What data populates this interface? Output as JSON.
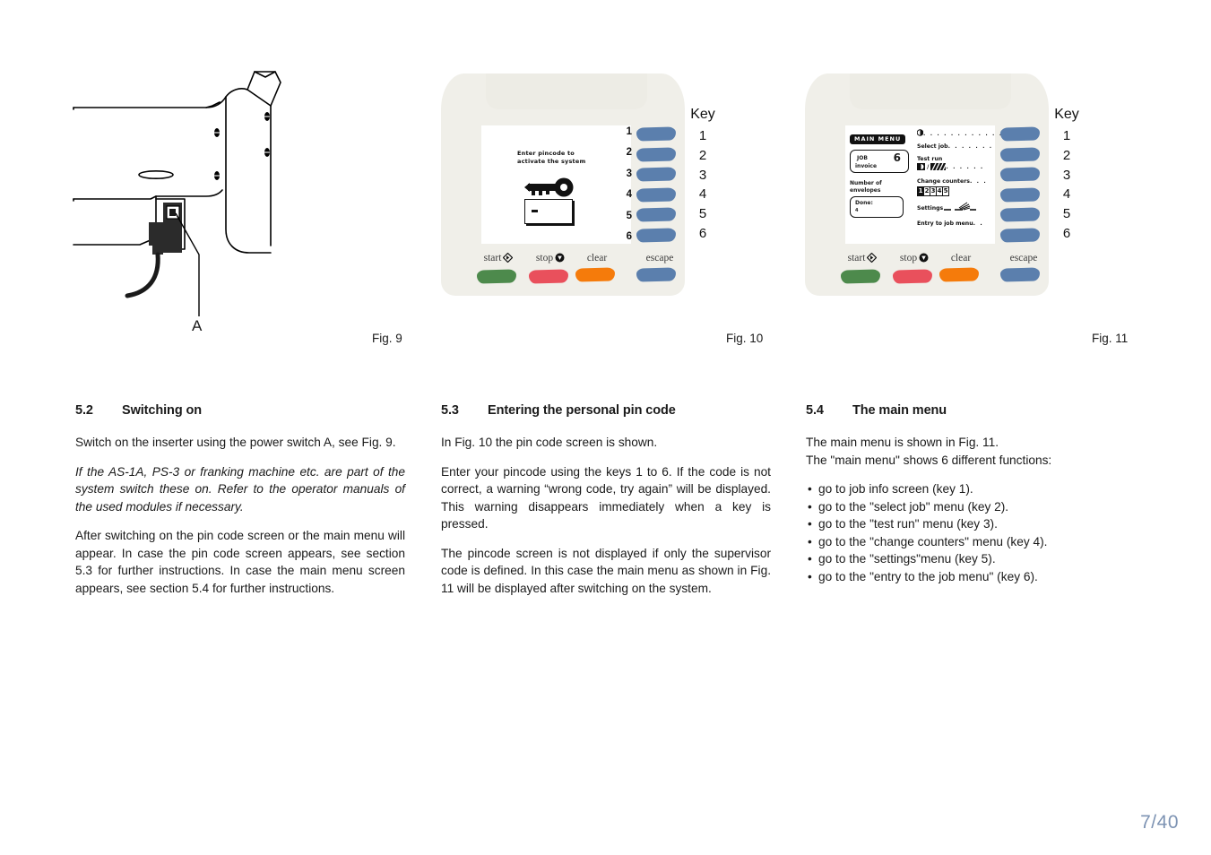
{
  "page": {
    "number": "7/40"
  },
  "figures": {
    "fig9": {
      "caption": "Fig. 9",
      "callout_label": "A",
      "description": "Line drawing of inserter rear corner showing power switch A and mains cable"
    },
    "fig10": {
      "caption": "Fig. 10",
      "key_column_title": "Key",
      "key_numbers": [
        "1",
        "2",
        "3",
        "4",
        "5",
        "6"
      ],
      "inner_numbers": [
        "1",
        "2",
        "3",
        "4",
        "5",
        "6"
      ],
      "buttons": {
        "start": "start",
        "stop": "stop",
        "clear": "clear",
        "escape": "escape"
      },
      "screen": {
        "message_line1": "Enter pincode to",
        "message_line2": "activate the system",
        "icon": "key-icon",
        "input_value": "-"
      }
    },
    "fig11": {
      "caption": "Fig. 11",
      "key_column_title": "Key",
      "key_numbers": [
        "1",
        "2",
        "3",
        "4",
        "5",
        "6"
      ],
      "buttons": {
        "start": "start",
        "stop": "stop",
        "clear": "clear",
        "escape": "escape"
      },
      "screen": {
        "title": "MAIN MENU",
        "job_label": "JOB",
        "job_number": "6",
        "job_name": "invoice",
        "envelopes_label_line1": "Number of",
        "envelopes_label_line2": "envelopes",
        "done_label": "Done:",
        "done_value": "4",
        "menu_items": [
          {
            "label": "",
            "dots": ". . . . . . . . . . . .",
            "icon": "job-info-icon"
          },
          {
            "label": "Select job",
            "dots": ". . . . . . .",
            "icon": ""
          },
          {
            "label": "Test run",
            "dots": ". . . . . .",
            "icon": "contrast-hatch-icon"
          },
          {
            "label": "Change counters",
            "dots": ". . .",
            "icon": "counter-segments"
          },
          {
            "label": "Settings",
            "dots": "",
            "icon": "settings-hand-icon"
          },
          {
            "label": "Entry to job menu",
            "dots": ". .",
            "icon": ""
          }
        ],
        "counter_segments": [
          "1",
          "2",
          "3",
          "4",
          "5"
        ],
        "counter_active_index": 0
      }
    }
  },
  "sections": {
    "s52": {
      "number": "5.2",
      "title": "Switching on",
      "p1": "Switch on the inserter using the power switch A, see Fig. 9.",
      "p2": "If the AS-1A, PS-3 or franking machine etc. are part of the system switch these on. Refer to the operator manuals of the used modules if necessary.",
      "p3": "After switching on the pin code screen or the main menu will appear. In case the pin code screen appears, see section 5.3 for further instructions. In case the main menu screen appears, see section 5.4 for further instructions."
    },
    "s53": {
      "number": "5.3",
      "title": "Entering the personal pin code",
      "p1": "In Fig. 10  the pin code screen is shown.",
      "p2": "Enter your pincode using the keys 1 to 6. If the code is not correct, a warning “wrong code, try again” will be displayed. This warning disappears immediately when a key is pressed.",
      "p3": "The pincode screen is not displayed if only the supervisor code is defined. In this case the main menu as shown in Fig. 11  will be displayed after switching on the system."
    },
    "s54": {
      "number": "5.4",
      "title": "The main menu",
      "p1": "The main menu is shown in Fig. 11.",
      "p2": "The \"main menu\" shows 6 different functions:",
      "bullets": [
        "go to job info screen (key 1).",
        "go to the \"select job\" menu (key 2).",
        "go to the \"test run\" menu (key 3).",
        "go to the \"change counters\" menu (key 4).",
        "go to the \"settings\"menu (key 5).",
        "go to the \"entry to the job menu\" (key 6)."
      ]
    }
  },
  "colors": {
    "panel_background": "#f0efe9",
    "key_blue": "#5b7fad",
    "start_green": "#4d8a4c",
    "stop_red": "#e9505c",
    "clear_orange": "#f57b0b",
    "page_number": "#7d93b3"
  }
}
